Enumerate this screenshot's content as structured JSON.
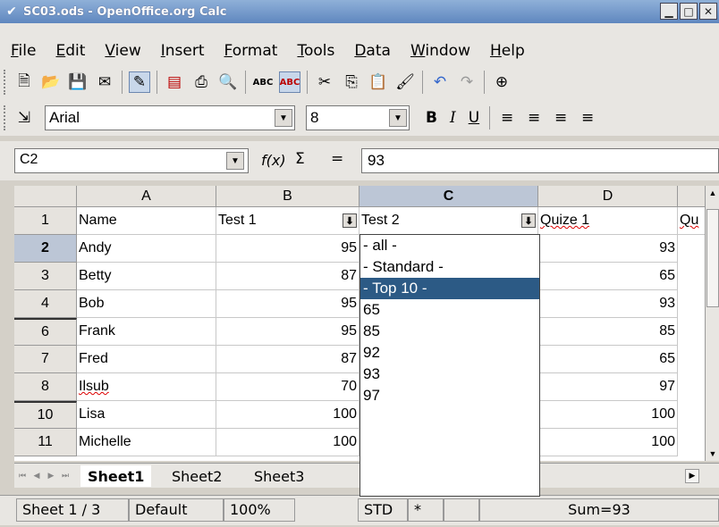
{
  "window": {
    "title": "SC03.ods - OpenOffice.org Calc",
    "min": "▁",
    "max": "□",
    "close": "✕"
  },
  "menu": [
    "File",
    "Edit",
    "View",
    "Insert",
    "Format",
    "Tools",
    "Data",
    "Window",
    "Help"
  ],
  "toolbar2": {
    "font_name": "Arial",
    "font_size": "8",
    "bold": "B",
    "italic": "I",
    "underline": "U"
  },
  "formula_bar": {
    "name_box": "C2",
    "fx": "f(x)",
    "sigma": "Σ",
    "equals": "=",
    "content": "93"
  },
  "columns": [
    "A",
    "B",
    "C",
    "D"
  ],
  "header_row": {
    "row": "1",
    "a": "Name",
    "b": "Test 1",
    "c": "Test 2",
    "d": "Quize 1",
    "e": "Qu"
  },
  "rows": [
    {
      "row": "2",
      "name": "Andy",
      "test1": "95",
      "quiz1": "93"
    },
    {
      "row": "3",
      "name": "Betty",
      "test1": "87",
      "quiz1": "65"
    },
    {
      "row": "4",
      "name": "Bob",
      "test1": "95",
      "quiz1": "93"
    },
    {
      "row": "6",
      "name": "Frank",
      "test1": "95",
      "quiz1": "85"
    },
    {
      "row": "7",
      "name": "Fred",
      "test1": "87",
      "quiz1": "65"
    },
    {
      "row": "8",
      "name": "Ilsub",
      "test1": "70",
      "quiz1": "97"
    },
    {
      "row": "10",
      "name": "Lisa",
      "test1": "100",
      "quiz1": "100"
    },
    {
      "row": "11",
      "name": "Michelle",
      "test1": "100",
      "quiz1": "100"
    }
  ],
  "autofilter_options": [
    "- all -",
    "- Standard -",
    "- Top 10 -",
    "65",
    "85",
    "92",
    "93",
    "97"
  ],
  "autofilter_highlighted": "- Top 10 -",
  "sheets": [
    "Sheet1",
    "Sheet2",
    "Sheet3"
  ],
  "status": {
    "sheet": "Sheet 1 / 3",
    "style": "Default",
    "zoom": "100%",
    "mode": "STD",
    "modified": "*",
    "sum": "Sum=93"
  }
}
